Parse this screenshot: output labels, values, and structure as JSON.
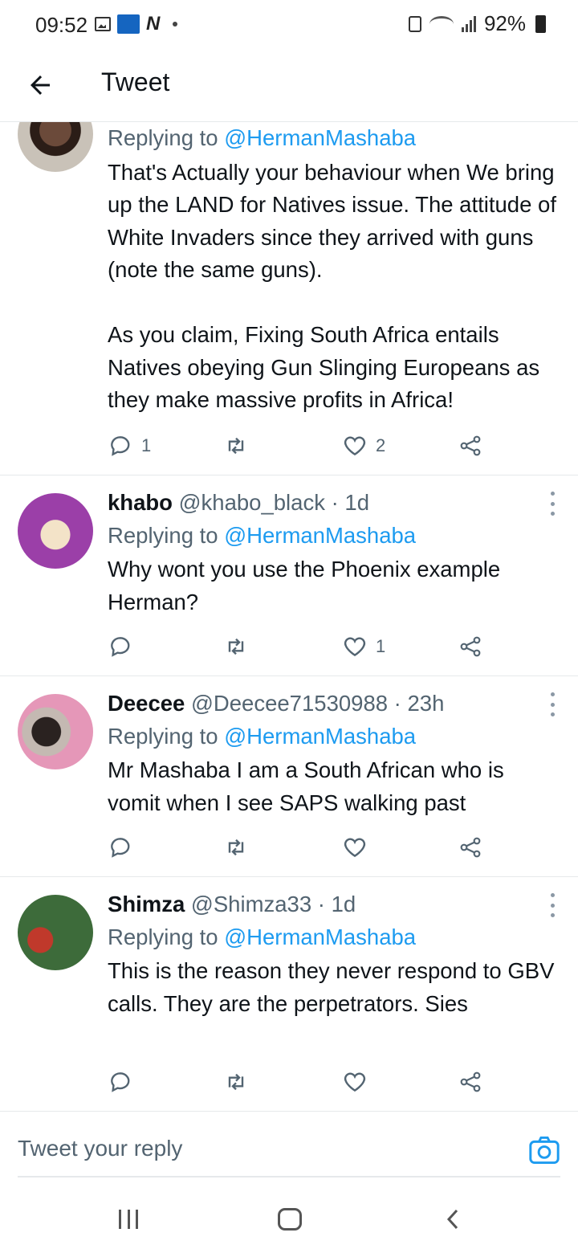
{
  "status_bar": {
    "time": "09:52",
    "battery": "92%",
    "icons": [
      "image-icon",
      "news-app-icon",
      "n-app-icon",
      "dot-icon",
      "secure-folder-icon",
      "wifi-icon",
      "signal-icon",
      "battery-icon"
    ]
  },
  "header": {
    "title": "Tweet",
    "back_icon": "back-arrow-icon"
  },
  "tweets": [
    {
      "name": "",
      "handle": "",
      "time": "",
      "replying_prefix": "Replying to ",
      "replying_to": "@HermanMashaba",
      "text": "That's Actually your behaviour when We bring up the LAND for Natives issue. The attitude of White Invaders since they arrived with guns (note the same guns).\n\nAs you claim, Fixing South Africa entails Natives obeying Gun Slinging Europeans as they make massive profits in Africa!",
      "reply_count": "1",
      "retweet_count": "",
      "like_count": "2"
    },
    {
      "name": "khabo",
      "handle": "@khabo_black",
      "time": "1d",
      "replying_prefix": "Replying to ",
      "replying_to": "@HermanMashaba",
      "text": "Why wont you use the Phoenix example Herman?",
      "reply_count": "",
      "retweet_count": "",
      "like_count": "1"
    },
    {
      "name": "Deecee",
      "handle": "@Deecee71530988",
      "time": "23h",
      "replying_prefix": "Replying to ",
      "replying_to": "@HermanMashaba",
      "text": "Mr Mashaba  I am a South African who is vomit when I see  SAPS walking past",
      "reply_count": "",
      "retweet_count": "",
      "like_count": ""
    },
    {
      "name": "Shimza",
      "handle": "@Shimza33",
      "time": "1d",
      "replying_prefix": "Replying to ",
      "replying_to": "@HermanMashaba",
      "text": "This is the reason they never respond to GBV calls. They are the perpetrators. Sies",
      "reply_count": "",
      "retweet_count": "",
      "like_count": ""
    }
  ],
  "reply_bar": {
    "placeholder": "Tweet your reply"
  },
  "colors": {
    "accent": "#1d9bf0",
    "secondary_text": "#536471",
    "divider": "#e6e9eb"
  }
}
